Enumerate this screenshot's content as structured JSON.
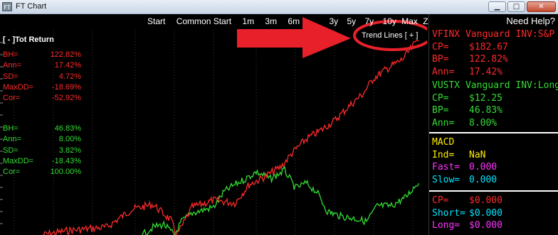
{
  "window": {
    "title": "FT Chart",
    "icon_label": "FT",
    "minimize": "▁",
    "maximize": "□",
    "close": "✕"
  },
  "range": {
    "buttons": [
      "Start",
      "Common Start",
      "1m",
      "3m",
      "6m",
      "3y",
      "5y",
      "7y",
      "10y",
      "Max",
      "Zoom"
    ]
  },
  "left_panel": {
    "title": "[ - ]Tot Return",
    "series1": [
      {
        "label": "BH=",
        "value": "122.82%"
      },
      {
        "label": "Ann=",
        "value": "17.42%"
      },
      {
        "label": "SD=",
        "value": "4.72%"
      },
      {
        "label": "MaxDD=",
        "value": "-18.69%"
      },
      {
        "label": "Cor=",
        "value": "-52.92%"
      }
    ],
    "series2": [
      {
        "label": "BH=",
        "value": "46.83%"
      },
      {
        "label": "Ann=",
        "value": "8.00%"
      },
      {
        "label": "SD=",
        "value": "3.82%"
      },
      {
        "label": "MaxDD=",
        "value": "-18.43%"
      },
      {
        "label": "Cor=",
        "value": "100.00%"
      }
    ]
  },
  "trend_lines": "Trend Lines [ + ]",
  "colors": {
    "series1": "#ff2a2a",
    "series2": "#33dd33",
    "annotation": "#e8202a"
  },
  "side": {
    "help": "Need Help?",
    "s1_name": "VFINX Vanguard INV:S&P",
    "s1": [
      {
        "label": "CP=",
        "value": "$182.67"
      },
      {
        "label": "BP=",
        "value": "122.82%"
      },
      {
        "label": "Ann=",
        "value": "17.42%"
      }
    ],
    "s2_name": "VUSTX Vanguard INV:Long",
    "s2": [
      {
        "label": "CP=",
        "value": "$12.25"
      },
      {
        "label": "BP=",
        "value": "46.83%"
      },
      {
        "label": "Ann=",
        "value": "8.00%"
      }
    ],
    "macd_title": "MACD",
    "macd": [
      {
        "label": "Ind=",
        "value": "NaN"
      },
      {
        "label": "Fast=",
        "value": "0.000"
      },
      {
        "label": "Slow=",
        "value": "0.000"
      }
    ],
    "pos": [
      {
        "label": "CP=",
        "value": "$0.000"
      },
      {
        "label": "Short=",
        "value": "$0.000"
      },
      {
        "label": "Long=",
        "value": "$0.000"
      }
    ]
  }
}
